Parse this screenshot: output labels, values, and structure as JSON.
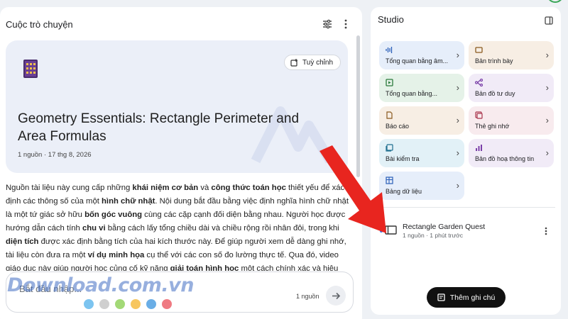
{
  "conversation": {
    "title": "Cuộc trò chuyện",
    "customize_label": "Tuỳ chỉnh",
    "notebook_title": "Geometry Essentials: Rectangle Perimeter and Area Formulas",
    "notebook_meta": "1 nguồn · 17 thg 8, 2026",
    "summary_parts": [
      "Nguồn tài liệu này cung cấp những ",
      "khái niệm cơ bản",
      " và ",
      "công thức toán học",
      " thiết yếu để xác định các thông số của một ",
      "hình chữ nhật",
      ". Nội dung bắt đầu bằng việc định nghĩa hình chữ nhật là một tứ giác sở hữu ",
      "bốn góc vuông",
      " cùng các cặp cạnh đối diện bằng nhau. Người học được hướng dẫn cách tính ",
      "chu vi",
      " bằng cách lấy tổng chiều dài và chiều rộng rồi nhân đôi, trong khi ",
      "diện tích",
      " được xác định bằng tích của hai kích thước này. Để giúp người xem dễ dàng ghi nhớ, tài liệu còn đưa ra một ",
      "ví dụ minh họa",
      " cụ thể với các con số đo lường thực tế. Qua đó, video giáo dục này giúp người học củng cố kỹ năng ",
      "giải toán hình học",
      " một cách chính xác và hiệu quả."
    ],
    "input_placeholder": "Bắt đầu nhập...",
    "source_count": "1 nguồn"
  },
  "watermark": {
    "text": "Download.com.vn",
    "dot_colors": [
      "#7cc4f0",
      "#cfcfcf",
      "#a3d977",
      "#f7c65f",
      "#6aaee6",
      "#ef7a82"
    ]
  },
  "studio": {
    "title": "Studio",
    "tiles": [
      {
        "label": "Tổng quan bằng âm...",
        "icon": "audio-icon"
      },
      {
        "label": "Bản trình bày",
        "icon": "slides-icon"
      },
      {
        "label": "Tổng quan bằng...",
        "icon": "video-icon"
      },
      {
        "label": "Bản đồ tư duy",
        "icon": "mindmap-icon"
      },
      {
        "label": "Báo cáo",
        "icon": "report-icon"
      },
      {
        "label": "Thẻ ghi nhớ",
        "icon": "flashcard-icon"
      },
      {
        "label": "Bài kiểm tra",
        "icon": "quiz-icon"
      },
      {
        "label": "Bản đồ hoạ thông tin",
        "icon": "infographic-icon"
      },
      {
        "label": "Bảng dữ liệu",
        "icon": "table-icon"
      }
    ],
    "note": {
      "title": "Rectangle Garden Quest",
      "meta": "1 nguồn · 1 phút trước"
    },
    "add_note_label": "Thêm ghi chú"
  },
  "colors": {
    "arrow": "#e8251f",
    "accent": "#3b78e7",
    "button_dark": "#111111"
  }
}
